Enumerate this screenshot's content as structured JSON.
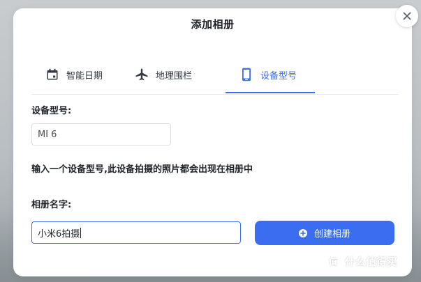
{
  "dialog": {
    "title": "添加相册"
  },
  "close": {
    "icon": "close-icon"
  },
  "tabs": [
    {
      "label": "智能日期",
      "icon": "calendar-icon",
      "active": false
    },
    {
      "label": "地理围栏",
      "icon": "airplane-icon",
      "active": false
    },
    {
      "label": "设备型号",
      "icon": "phone-icon",
      "active": true
    }
  ],
  "device_model": {
    "label": "设备型号:",
    "value": "MI 6",
    "hint": "输入一个设备型号,此设备拍摄的照片都会出现在相册中"
  },
  "album_name": {
    "label": "相册名字:",
    "value": "小米6拍摄"
  },
  "create_button": {
    "label": "创建相册",
    "icon": "plus-circle-icon"
  },
  "watermark": {
    "logo_text": "值",
    "text": "什么值得买"
  },
  "colors": {
    "accent": "#3a6df0",
    "text": "#1f2329",
    "border": "#dcdfe4"
  }
}
